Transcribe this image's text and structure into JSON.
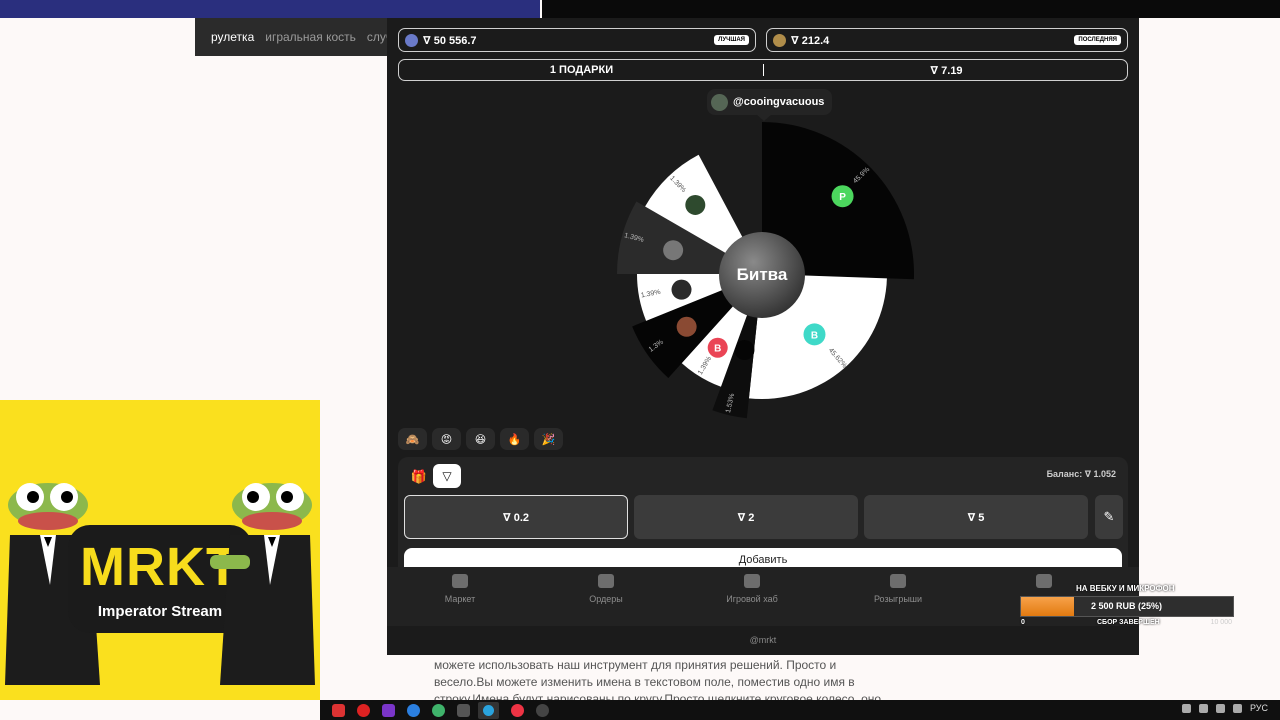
{
  "bg_tabs": [
    "рулетка",
    "игральная кость",
    "случа"
  ],
  "bg_text": "можете использовать наш инструмент для принятия решений. Просто и весело.Вы можете изменить имена в текстовом поле, поместив одно имя в строку.Имена будут нарисованы по кругу.Просто щелкните круговое колесо, оно начнет вращаться.",
  "sticker": {
    "title": "MRKT",
    "subtitle": "Imperator Stream"
  },
  "stats": {
    "best": {
      "value": "∇ 50 556.7",
      "tag": "ЛУЧШАЯ"
    },
    "last": {
      "value": "∇ 212.4",
      "tag": "ПОСЛЕДНЯЯ"
    }
  },
  "gifts_bar": {
    "gifts": "1 ПОДАРКИ",
    "pot": "∇ 7.19"
  },
  "current_player": "@cooingvacuous",
  "wheel": {
    "center_label": "Битва",
    "slices": [
      {
        "pct": "45.9%",
        "color": "#050505",
        "avatar": "#4cd75e",
        "avatar_letter": "Р"
      },
      {
        "pct": "45.62%",
        "color": "#ffffff",
        "avatar": "#3fd9c8",
        "avatar_letter": "В"
      },
      {
        "pct": "1.53%",
        "color": "#0d0d0d",
        "avatar": "#050505",
        "avatar_letter": ""
      },
      {
        "pct": "1.39%",
        "color": "#ffffff",
        "avatar": "#ea4455",
        "avatar_letter": "В"
      },
      {
        "pct": "1.3%",
        "color": "#050505",
        "avatar": "#8a4a33",
        "avatar_letter": ""
      },
      {
        "pct": "1.39%",
        "color": "#ffffff",
        "avatar": "#2a2a2a",
        "avatar_letter": ""
      },
      {
        "pct": "1.39%",
        "color": "#2b2b2b",
        "avatar": "#777777",
        "avatar_letter": ""
      },
      {
        "pct": "1.39%",
        "color": "#ffffff",
        "avatar": "#2e4a2e",
        "avatar_letter": ""
      }
    ]
  },
  "reactions": [
    "🙈",
    "😡",
    "😆",
    "🔥",
    "🎉"
  ],
  "bet": {
    "balance": "Баланс: ∇ 1.052",
    "amounts": [
      "∇ 0.2",
      "∇ 2",
      "∇ 5"
    ],
    "add_label": "Добавить"
  },
  "nav": [
    "Маркет",
    "Ордеры",
    "Игровой хаб",
    "Розыгрыши",
    ""
  ],
  "footer_handle": "@mrkt",
  "donation": {
    "title": "НА ВЕБКУ И МИКРОФОН",
    "amount": "2 500 RUB (25%)",
    "progress": 0.25,
    "min": "0",
    "status": "СБОР ЗАВЕРШЕН",
    "max": "10 000"
  },
  "taskbar": {
    "lang": "РУС"
  }
}
